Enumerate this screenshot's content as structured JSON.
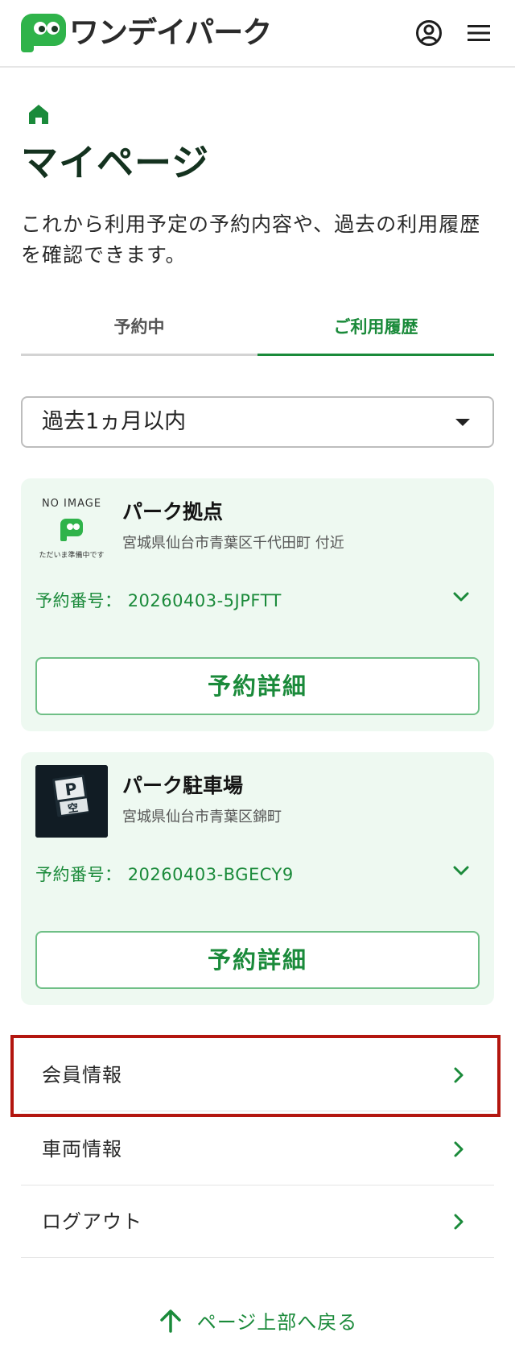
{
  "header": {
    "logo_text": "ワンデイパーク",
    "logo_mark": "P",
    "user_icon": "user-circle-icon",
    "menu_icon": "hamburger-menu-icon"
  },
  "breadcrumb": {
    "home_icon": "home-icon"
  },
  "page": {
    "title": "マイページ",
    "description": "これから利用予定の予約内容や、過去の利用履歴を確認できます。"
  },
  "tabs": [
    {
      "label": "予約中",
      "active": false
    },
    {
      "label": "ご利用履歴",
      "active": true
    }
  ],
  "filter": {
    "selected": "過去1ヵ月以内"
  },
  "reservations": [
    {
      "name": "パーク拠点",
      "address": "宮城県仙台市青葉区千代田町 付近",
      "number_label": "予約番号：",
      "number": "20260403-5JPFTT",
      "image": {
        "title": "NO IMAGE",
        "caption": "ただいま準備中です"
      },
      "detail_button": "予約詳細"
    },
    {
      "name": "パーク駐車場",
      "address": "宮城県仙台市青葉区錦町",
      "number_label": "予約番号：",
      "number": "20260403-BGECY9",
      "image": {
        "sign_top": "P",
        "sign_bottom": "空"
      },
      "detail_button": "予約詳細"
    }
  ],
  "menu": [
    {
      "label": "会員情報",
      "highlighted": true
    },
    {
      "label": "車両情報"
    },
    {
      "label": "ログアウト"
    }
  ],
  "back_to_top": "ページ上部へ戻る",
  "colors": {
    "brand_green": "#1a8a3a",
    "logo_green": "#2fb34a",
    "card_bg": "#eef9f1",
    "highlight_red": "#b3160f"
  }
}
